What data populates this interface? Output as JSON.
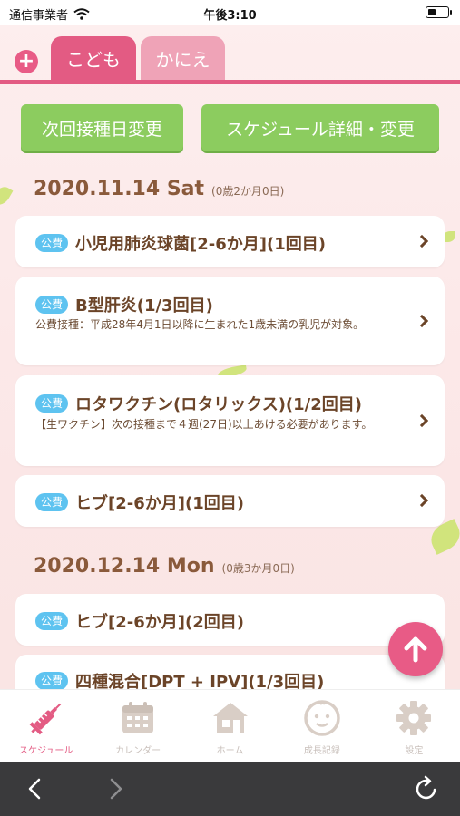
{
  "status_bar": {
    "carrier": "通信事業者",
    "time": "午後3:10",
    "battery_level": 0.4
  },
  "tabs": {
    "add_icon": "plus-icon",
    "items": [
      {
        "label": "こども",
        "active": true
      },
      {
        "label": "かにえ",
        "active": false
      }
    ]
  },
  "actions": {
    "next_date_change": "次回接種日変更",
    "schedule_detail": "スケジュール詳細・変更"
  },
  "schedule": [
    {
      "date": "2020.11.14 Sat",
      "age": "(0歳2か月0日)",
      "items": [
        {
          "badge": "公費",
          "title": "小児用肺炎球菌[2-6か月](1回目)",
          "note": ""
        },
        {
          "badge": "公費",
          "title": "B型肝炎(1/3回目)",
          "note": "公費接種：平成28年4月1日以降に生まれた1歳未満の乳児が対象。"
        },
        {
          "badge": "公費",
          "title": "ロタワクチン(ロタリックス)(1/2回目)",
          "note": "【生ワクチン】次の接種まで４週(27日)以上あける必要があります。"
        },
        {
          "badge": "公費",
          "title": "ヒブ[2-6か月](1回目)",
          "note": ""
        }
      ]
    },
    {
      "date": "2020.12.14 Mon",
      "age": "(0歳3か月0日)",
      "items": [
        {
          "badge": "公費",
          "title": "ヒブ[2-6か月](2回目)",
          "note": ""
        },
        {
          "badge": "公費",
          "title": "四種混合[DPT + IPV](1/3回目)",
          "note": ""
        }
      ]
    }
  ],
  "fab_icon": "arrow-up-icon",
  "bottom_nav": [
    {
      "label": "スケジュール",
      "icon": "syringe-icon",
      "active": true
    },
    {
      "label": "カレンダー",
      "icon": "calendar-icon",
      "active": false
    },
    {
      "label": "ホーム",
      "icon": "home-icon",
      "active": false
    },
    {
      "label": "成長記録",
      "icon": "baby-face-icon",
      "active": false
    },
    {
      "label": "設定",
      "icon": "gear-icon",
      "active": false
    }
  ],
  "browser_bar": {
    "back_icon": "chevron-left-icon",
    "forward_icon": "chevron-right-icon",
    "reload_icon": "reload-icon"
  },
  "colors": {
    "accent": "#e35b83",
    "tab_inactive": "#efa3b7",
    "button_green": "#8ccc5f",
    "badge_blue": "#5ec3f0",
    "text_brown": "#6b4428"
  }
}
